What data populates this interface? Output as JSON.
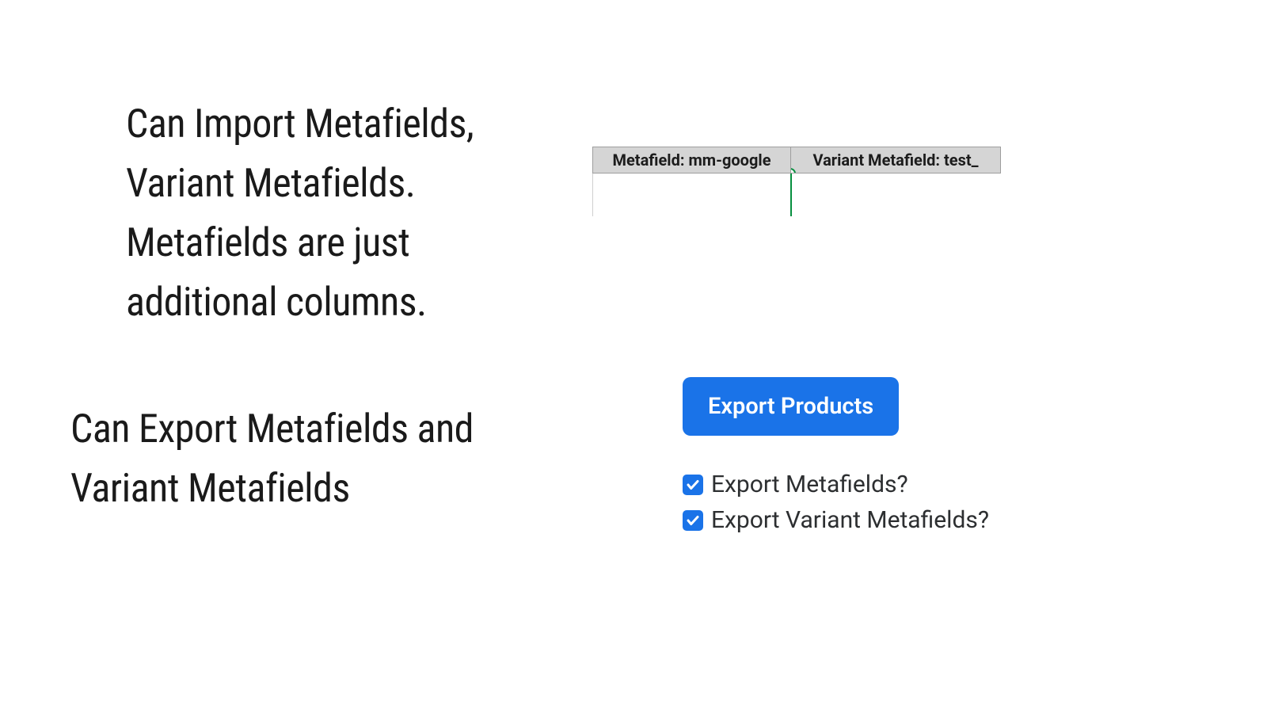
{
  "headings": {
    "import": "Can Import Metafields,\nVariant Metafields.\nMetafields are just\nadditional columns.",
    "export": "Can Export Metafields and\nVariant Metafields"
  },
  "spreadsheet": {
    "headers": {
      "col_a": "Metafield: mm-google",
      "col_b": "Variant Metafield: test_"
    }
  },
  "export_panel": {
    "button_label": "Export Products",
    "checkbox_metafields": {
      "label": "Export Metafields?",
      "checked": true
    },
    "checkbox_variant_metafields": {
      "label": "Export Variant Metafields?",
      "checked": true
    }
  }
}
